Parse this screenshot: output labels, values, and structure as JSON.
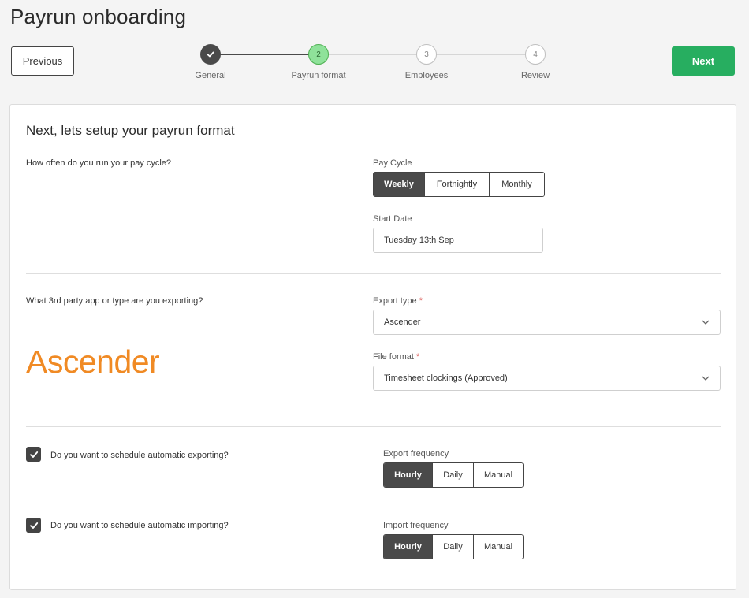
{
  "page": {
    "title": "Payrun onboarding"
  },
  "nav": {
    "previous_label": "Previous",
    "next_label": "Next"
  },
  "stepper": {
    "steps": [
      {
        "number": "1",
        "label": "General",
        "state": "done"
      },
      {
        "number": "2",
        "label": "Payrun format",
        "state": "current"
      },
      {
        "number": "3",
        "label": "Employees",
        "state": "todo"
      },
      {
        "number": "4",
        "label": "Review",
        "state": "todo"
      }
    ]
  },
  "form": {
    "heading": "Next, lets setup your payrun format",
    "pay_cycle": {
      "question": "How often do you run your pay cycle?",
      "label": "Pay Cycle",
      "options": [
        "Weekly",
        "Fortnightly",
        "Monthly"
      ],
      "selected": "Weekly",
      "start_date_label": "Start Date",
      "start_date_value": "Tuesday 13th Sep"
    },
    "export": {
      "question": "What 3rd party app or type are you exporting?",
      "type_label": "Export type",
      "type_value": "Ascender",
      "format_label": "File format",
      "format_value": "Timesheet clockings (Approved)",
      "required_mark": "*",
      "logo_text": "Ascender"
    },
    "schedule_export": {
      "question": "Do you want to schedule automatic exporting?",
      "checked": true,
      "label": "Export frequency",
      "options": [
        "Hourly",
        "Daily",
        "Manual"
      ],
      "selected": "Hourly"
    },
    "schedule_import": {
      "question": "Do you want to schedule automatic importing?",
      "checked": true,
      "label": "Import frequency",
      "options": [
        "Hourly",
        "Daily",
        "Manual"
      ],
      "selected": "Hourly"
    }
  },
  "colors": {
    "accent_green": "#27ae60",
    "step_current": "#8fe29a",
    "dark": "#4a4a4a",
    "logo_orange": "#f08a24"
  }
}
